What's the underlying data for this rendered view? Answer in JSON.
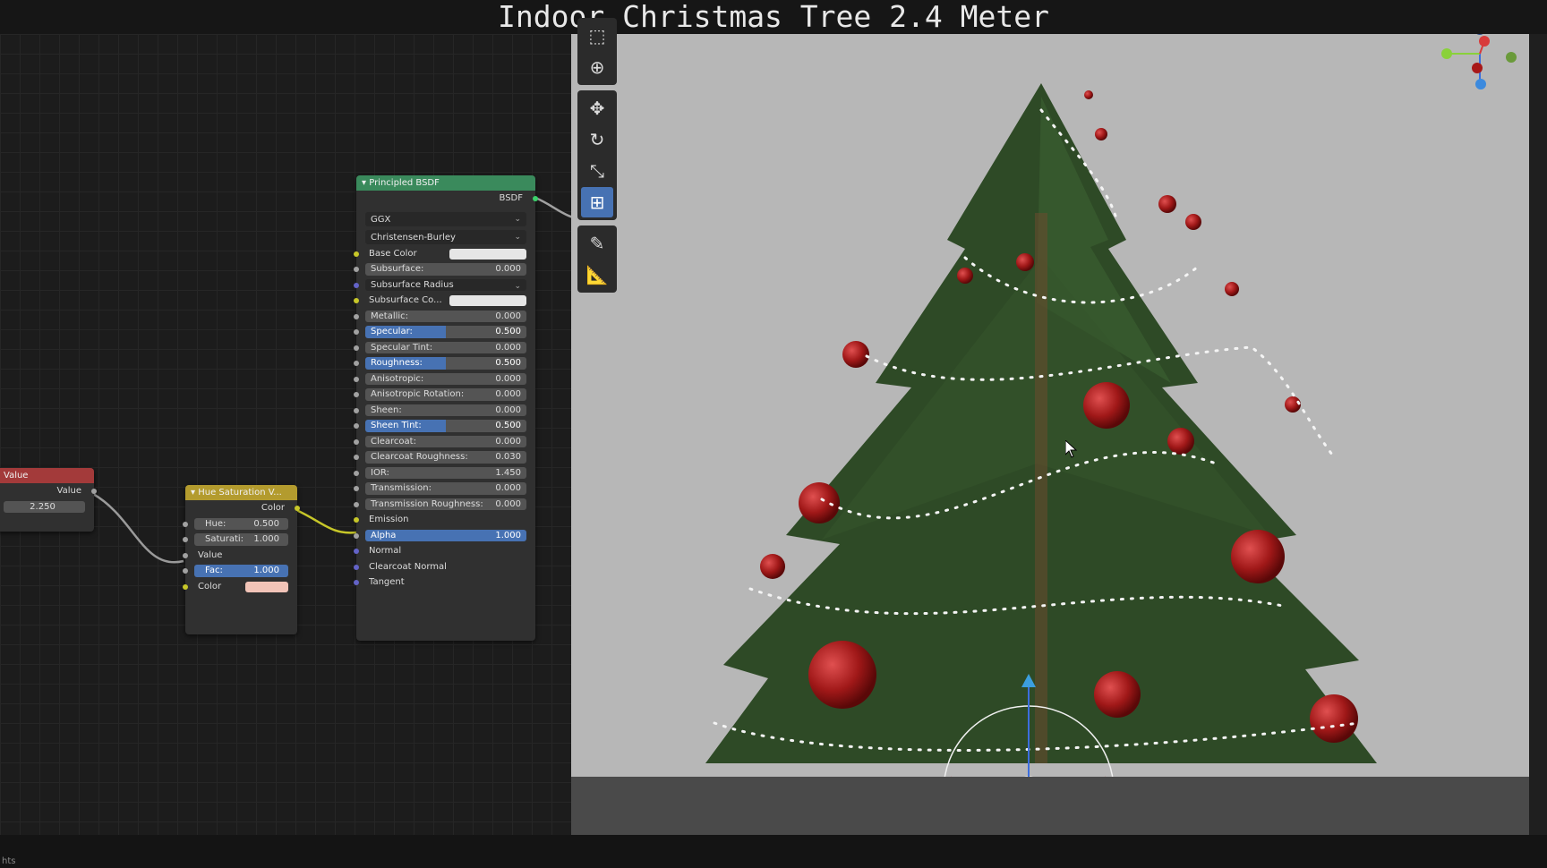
{
  "window": {
    "title": "Indoor Christmas Tree 2.4 Meter"
  },
  "colors": {
    "accent": "#4772b3",
    "shader_header": "#3a8a5c",
    "input_header": "#a33a3a",
    "color_header": "#b39b2e",
    "viewport_bg": "#b7b7b7"
  },
  "value_node": {
    "header": "Value",
    "output_label": "Value",
    "value": "2.250"
  },
  "hue_node": {
    "header": "Hue Saturation V...",
    "output_label": "Color",
    "hue_label": "Hue:",
    "hue_value": "0.500",
    "sat_label": "Saturati:",
    "sat_value": "1.000",
    "value_label": "Value",
    "fac_label": "Fac:",
    "fac_value": "1.000",
    "color_label": "Color",
    "color_swatch": "#f2c4b8"
  },
  "bsdf_node": {
    "header": "Principled BSDF",
    "output_label": "BSDF",
    "distribution": "GGX",
    "subsurface_method": "Christensen-Burley",
    "rows": [
      {
        "label": "Base Color",
        "kind": "color",
        "socket": "y"
      },
      {
        "label": "Subsurface:",
        "value": "0.000",
        "kind": "field",
        "socket": "g"
      },
      {
        "label": "Subsurface Radius",
        "kind": "dropdown",
        "socket": "p"
      },
      {
        "label": "Subsurface Co...",
        "kind": "color",
        "socket": "y"
      },
      {
        "label": "Metallic:",
        "value": "0.000",
        "kind": "field",
        "socket": "g"
      },
      {
        "label": "Specular:",
        "value": "0.500",
        "kind": "blue",
        "socket": "g",
        "fill": 0.5
      },
      {
        "label": "Specular Tint:",
        "value": "0.000",
        "kind": "field",
        "socket": "g"
      },
      {
        "label": "Roughness:",
        "value": "0.500",
        "kind": "blue",
        "socket": "g",
        "fill": 0.5
      },
      {
        "label": "Anisotropic:",
        "value": "0.000",
        "kind": "field",
        "socket": "g"
      },
      {
        "label": "Anisotropic Rotation:",
        "value": "0.000",
        "kind": "field",
        "socket": "g"
      },
      {
        "label": "Sheen:",
        "value": "0.000",
        "kind": "field",
        "socket": "g"
      },
      {
        "label": "Sheen Tint:",
        "value": "0.500",
        "kind": "blue",
        "socket": "g",
        "fill": 0.5
      },
      {
        "label": "Clearcoat:",
        "value": "0.000",
        "kind": "field",
        "socket": "g"
      },
      {
        "label": "Clearcoat Roughness:",
        "value": "0.030",
        "kind": "field",
        "socket": "g"
      },
      {
        "label": "IOR:",
        "value": "1.450",
        "kind": "field",
        "socket": "g"
      },
      {
        "label": "Transmission:",
        "value": "0.000",
        "kind": "field",
        "socket": "g"
      },
      {
        "label": "Transmission Roughness:",
        "value": "0.000",
        "kind": "field",
        "socket": "g"
      },
      {
        "label": "Emission",
        "kind": "plain",
        "socket": "y"
      },
      {
        "label": "Alpha",
        "value": "1.000",
        "kind": "blue",
        "socket": "g",
        "fill": 1.0
      },
      {
        "label": "Normal",
        "kind": "plain",
        "socket": "p"
      },
      {
        "label": "Clearcoat Normal",
        "kind": "plain",
        "socket": "p"
      },
      {
        "label": "Tangent",
        "kind": "plain",
        "socket": "p"
      }
    ]
  },
  "toolbar": [
    "select-box-icon",
    "cursor-icon",
    "move-icon",
    "rotate-icon",
    "scale-icon",
    "transform-icon",
    "annotate-icon",
    "measure-icon"
  ],
  "status_bar": {
    "text": "hts"
  }
}
